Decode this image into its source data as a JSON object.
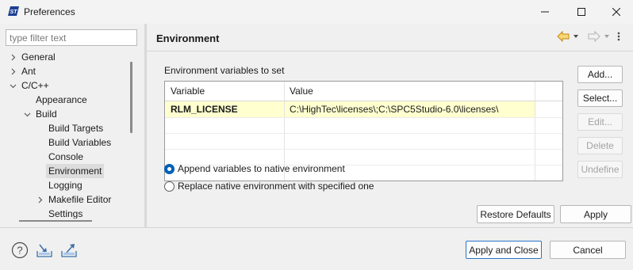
{
  "window": {
    "title": "Preferences",
    "minimize_glyph": "minimize-icon",
    "maximize_glyph": "maximize-icon",
    "close_glyph": "close-icon"
  },
  "filter": {
    "placeholder": "type filter text",
    "value": ""
  },
  "tree": {
    "items": [
      {
        "label": "General",
        "level": 0,
        "expander": "collapsed"
      },
      {
        "label": "Ant",
        "level": 0,
        "expander": "collapsed"
      },
      {
        "label": "C/C++",
        "level": 0,
        "expander": "expanded"
      },
      {
        "label": "Appearance",
        "level": 1,
        "expander": "none"
      },
      {
        "label": "Build",
        "level": 1,
        "expander": "expanded"
      },
      {
        "label": "Build Targets",
        "level": 2,
        "expander": "none"
      },
      {
        "label": "Build Variables",
        "level": 2,
        "expander": "none"
      },
      {
        "label": "Console",
        "level": 2,
        "expander": "none"
      },
      {
        "label": "Environment",
        "level": 2,
        "expander": "none",
        "selected": true
      },
      {
        "label": "Logging",
        "level": 2,
        "expander": "none"
      },
      {
        "label": "Makefile Editor",
        "level": 2,
        "expander": "collapsed"
      },
      {
        "label": "Settings",
        "level": 2,
        "expander": "none"
      }
    ]
  },
  "page": {
    "title": "Environment",
    "section_label": "Environment variables to set",
    "table": {
      "headers": [
        "Variable",
        "Value"
      ],
      "rows": [
        {
          "variable": "RLM_LICENSE",
          "value": "C:\\HighTec\\licenses\\;C:\\SPC5Studio-6.0\\licenses\\"
        }
      ]
    },
    "side_buttons": {
      "add": "Add...",
      "select": "Select...",
      "edit": "Edit...",
      "delete": "Delete",
      "undefine": "Undefine"
    },
    "radio_append": {
      "label": "Append variables to native environment",
      "checked": true
    },
    "radio_replace": {
      "label": "Replace native environment with specified one",
      "checked": false
    },
    "restore_defaults": "Restore Defaults",
    "apply": "Apply"
  },
  "footer": {
    "apply_and_close": "Apply and Close",
    "cancel": "Cancel",
    "icons": [
      "help-icon",
      "import-icon",
      "export-icon"
    ]
  },
  "colors": {
    "accent": "#005fb8",
    "nav_arrow": "#d9a21b",
    "row_highlight": "#ffffcf"
  }
}
